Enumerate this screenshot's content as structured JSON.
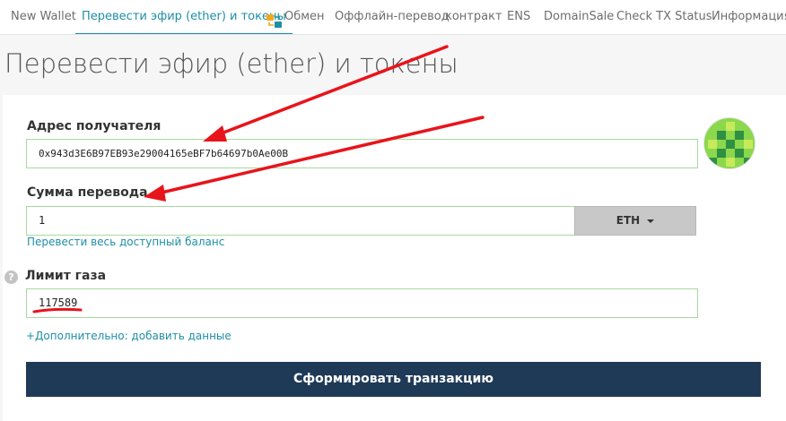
{
  "nav": {
    "items": [
      {
        "label": "New Wallet"
      },
      {
        "label": "Перевести эфир (ether) и токены",
        "active": true
      },
      {
        "label": "Обмен",
        "icon": "swap-icon"
      },
      {
        "label": "Оффлайн-перевод"
      },
      {
        "label": "контракт"
      },
      {
        "label": "ENS"
      },
      {
        "label": "DomainSale"
      },
      {
        "label": "Check TX Status"
      },
      {
        "label": "Информация о"
      }
    ]
  },
  "page": {
    "title": "Перевести эфир (ether) и токены"
  },
  "form": {
    "recipient_label": "Адрес получателя",
    "recipient_value": "0x943d3E6B97EB93e29004165eBF7b64697b0Ae00B",
    "amount_label": "Сумма перевода",
    "amount_value": "1",
    "unit": "ETH",
    "send_all_link": "Перевести весь доступный баланс",
    "gas_label": "Лимит газа",
    "gas_value": "117589",
    "advanced_link": "+Дополнительно: добавить данные",
    "help_glyph": "?",
    "submit_label": "Сформировать транзакцию"
  },
  "colors": {
    "accent": "#1d8fa7",
    "button": "#1f3a57",
    "field_border": "#a8d8a0",
    "annotation": "#e8141b"
  }
}
